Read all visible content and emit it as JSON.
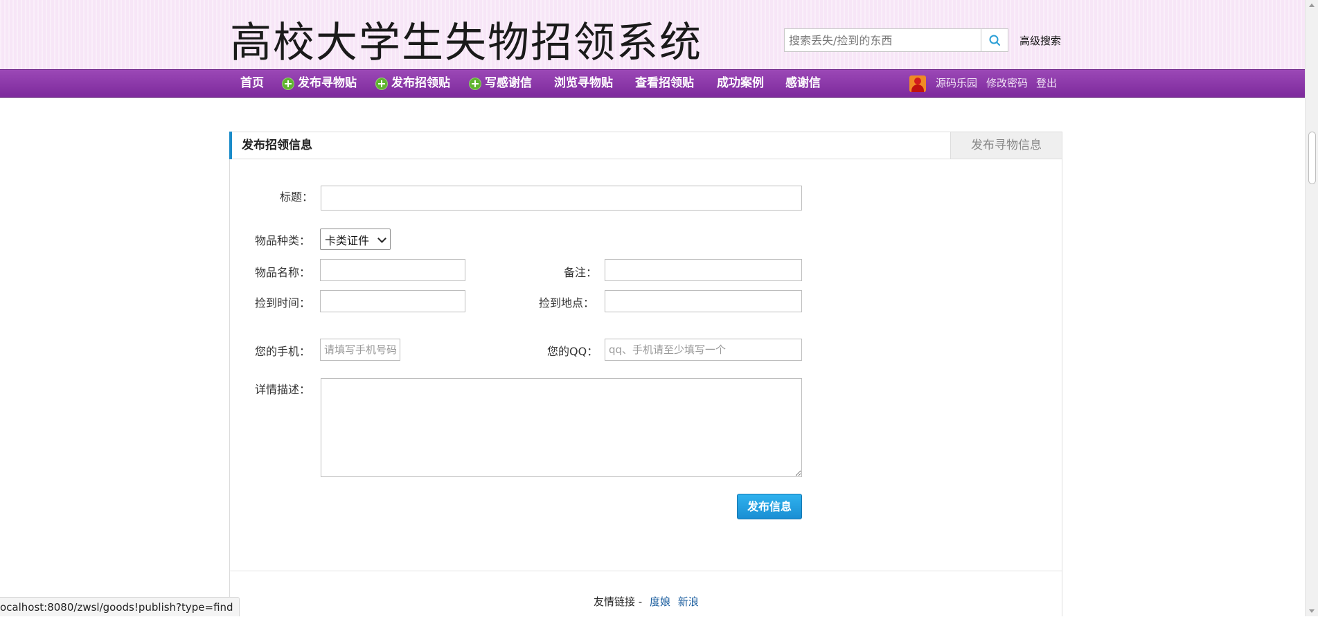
{
  "header": {
    "site_title": "高校大学生失物招领系统",
    "search_placeholder": "搜索丢失/捡到的东西",
    "advanced_search": "高级搜索"
  },
  "nav": {
    "items": [
      {
        "label": "首页",
        "icon": null
      },
      {
        "label": "发布寻物贴",
        "icon": "plus-circle-icon"
      },
      {
        "label": "发布招领贴",
        "icon": "plus-circle-icon"
      },
      {
        "label": "写感谢信",
        "icon": "plus-circle-icon"
      },
      {
        "label": "浏览寻物贴",
        "icon": null
      },
      {
        "label": "查看招领贴",
        "icon": null
      },
      {
        "label": "成功案例",
        "icon": null
      },
      {
        "label": "感谢信",
        "icon": null
      }
    ],
    "user": {
      "name": "源码乐园",
      "change_password": "修改密码",
      "logout": "登出"
    }
  },
  "panel": {
    "title": "发布招领信息",
    "other_tab": "发布寻物信息"
  },
  "form": {
    "title_label": "标题：",
    "title_value": "",
    "category_label": "物品种类：",
    "category_selected": "卡类证件",
    "item_name_label": "物品名称：",
    "item_name_value": "",
    "note_label": "备注：",
    "note_value": "",
    "found_time_label": "捡到时间：",
    "found_time_value": "",
    "found_place_label": "捡到地点：",
    "found_place_value": "",
    "phone_label": "您的手机：",
    "phone_placeholder": "请填写手机号码",
    "qq_label": "您的QQ：",
    "qq_placeholder": "qq、手机请至少填写一个",
    "description_label": "详情描述：",
    "description_value": "",
    "submit_label": "发布信息"
  },
  "footer": {
    "links_label": "友情链接 -",
    "links": [
      "度娘",
      "新浪"
    ]
  },
  "status_bar": {
    "url": "ocalhost:8080/zwsl/goods!publish?type=find"
  },
  "colors": {
    "nav_bg": "#8a35a8",
    "header_bg": "#f7e6f7",
    "accent_blue": "#1a8bc9",
    "plus_icon_green": "#5fb42f"
  }
}
